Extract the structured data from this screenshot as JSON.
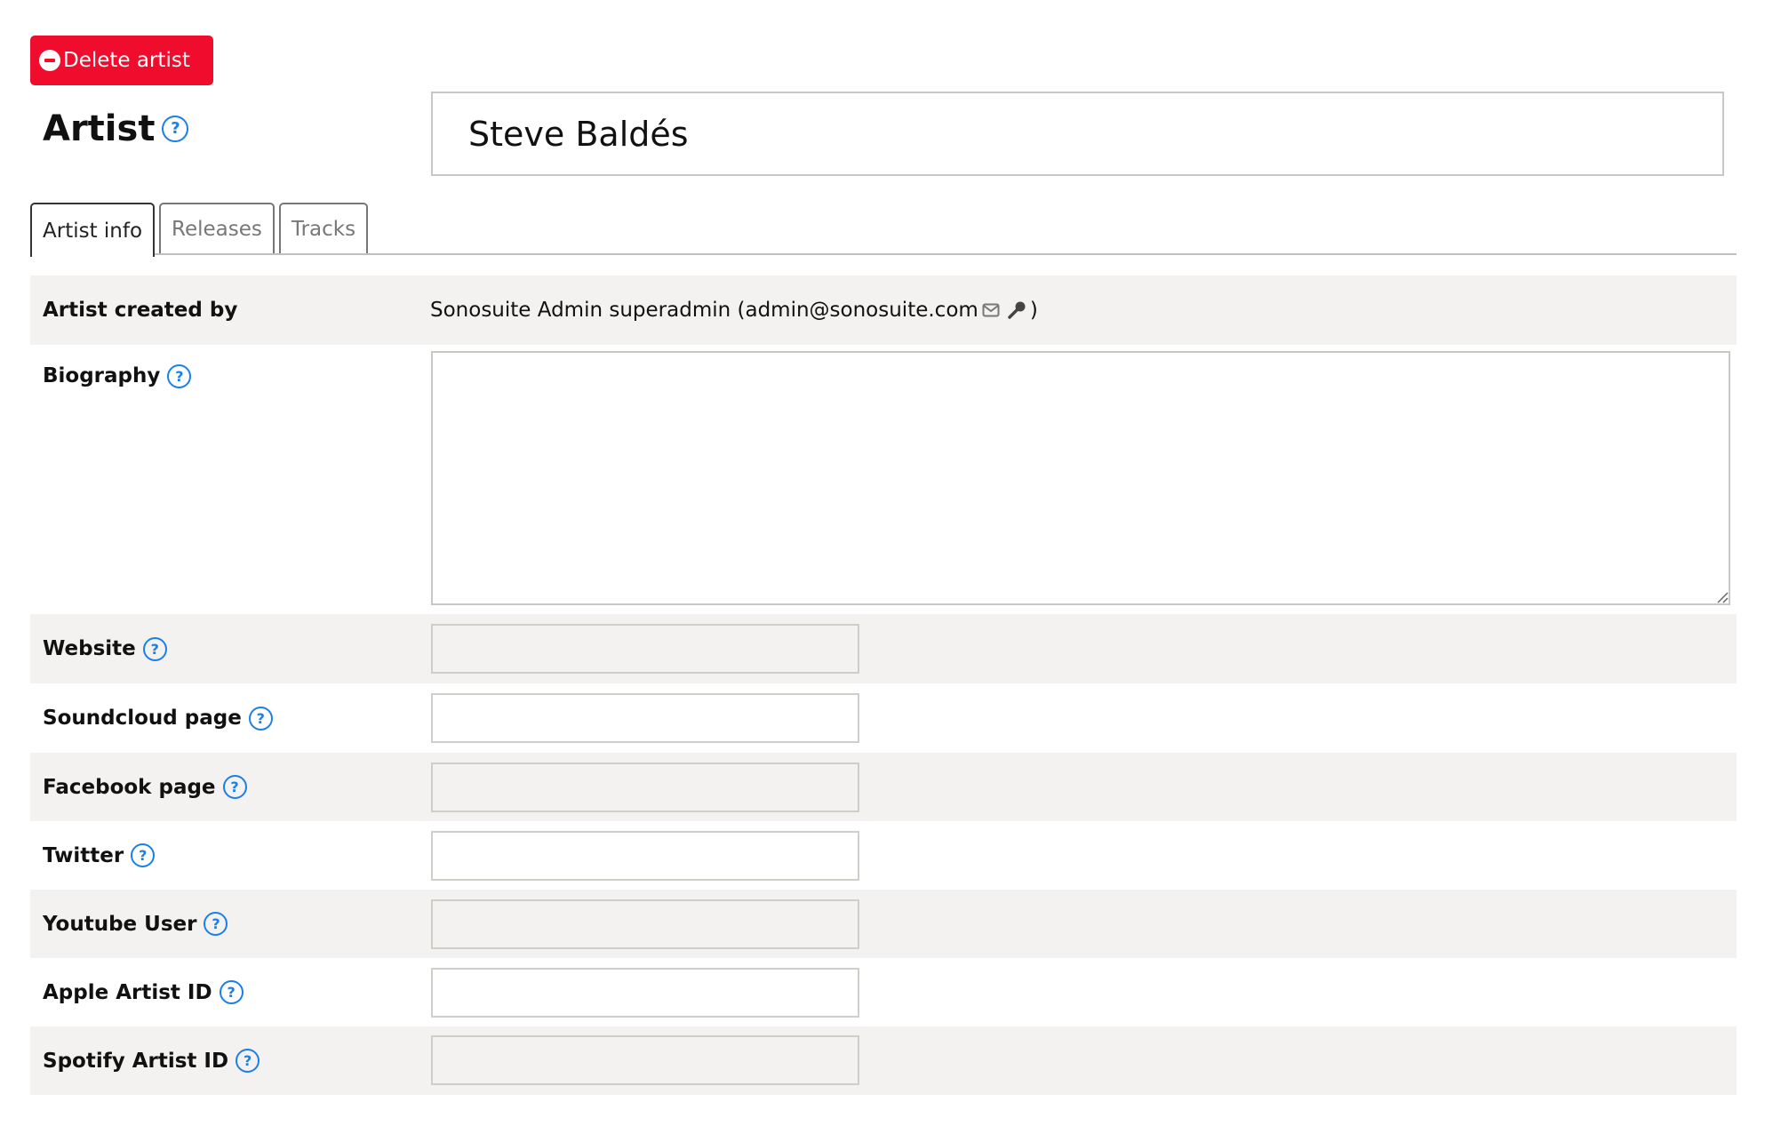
{
  "actions": {
    "delete_label": "Delete artist"
  },
  "header": {
    "title": "Artist",
    "artist_name": "Steve Baldés"
  },
  "tabs": [
    {
      "label": "Artist info",
      "active": true
    },
    {
      "label": "Releases",
      "active": false
    },
    {
      "label": "Tracks",
      "active": false
    }
  ],
  "fields": {
    "created_by": {
      "label": "Artist created by",
      "value": "Sonosuite Admin superadmin (admin@sonosuite.com",
      "closing": ")",
      "icons": [
        "envelope-icon",
        "key-icon"
      ]
    },
    "biography": {
      "label": "Biography",
      "value": ""
    },
    "website": {
      "label": "Website",
      "value": ""
    },
    "soundcloud": {
      "label": "Soundcloud page",
      "value": ""
    },
    "facebook": {
      "label": "Facebook page",
      "value": ""
    },
    "twitter": {
      "label": "Twitter",
      "value": ""
    },
    "youtube": {
      "label": "Youtube User",
      "value": ""
    },
    "apple": {
      "label": "Apple Artist ID",
      "value": ""
    },
    "spotify": {
      "label": "Spotify Artist ID",
      "value": ""
    }
  },
  "help_glyph": "?",
  "colors": {
    "danger": "#f00c2c",
    "help": "#1a7fe6",
    "row_alt": "#f3f2f0"
  }
}
